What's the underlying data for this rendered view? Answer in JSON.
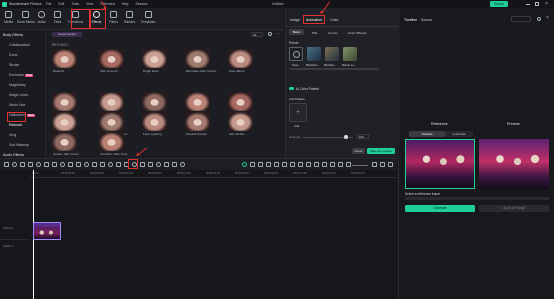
{
  "titlebar": {
    "app_name": "Wondershare Filmora",
    "menus": [
      "File",
      "Edit",
      "Tools",
      "View",
      "Extended",
      "Help",
      "Session"
    ],
    "project": "Untitled",
    "export_label": "Export"
  },
  "toolbar": {
    "tools": [
      {
        "label": "Media",
        "icon": "media-icon"
      },
      {
        "label": "Stock Media",
        "icon": "stock-media-icon"
      },
      {
        "label": "Audio",
        "icon": "audio-icon"
      },
      {
        "label": "Titles",
        "icon": "titles-icon"
      },
      {
        "label": "Transitions",
        "icon": "transitions-icon"
      },
      {
        "label": "Effects",
        "icon": "effects-icon"
      },
      {
        "label": "Filters",
        "icon": "filters-icon"
      },
      {
        "label": "Stickers",
        "icon": "stickers-icon"
      },
      {
        "label": "Templates",
        "icon": "templates-icon"
      }
    ]
  },
  "sidebar": {
    "category": "Body Effects",
    "items": [
      "Collaboration",
      "Done",
      "Stroke",
      "Exclusive",
      "MagicWay",
      "Magic Lines",
      "Neon Line",
      "Halloween",
      "Retouch",
      "Vlog",
      "Suit Makeup"
    ],
    "audio_category": "Audio Effects",
    "badge_exclusive": "NEW",
    "badge_halloween": "NEW"
  },
  "effects": {
    "search_placeholder": "Search effects",
    "filter_label": "Asset Center",
    "filter_value": "All",
    "section": "RETOUCH",
    "thumbs": [
      "Beautify",
      "Skin Smooth",
      "Bright Eyes",
      "Eliminate Dark Circles",
      "Face Blush",
      "Makeup",
      "Slim Face",
      "Face Slim",
      "Forehead",
      "Whitening",
      "AI Smile",
      "Skin Color Enhance",
      "Face Lighting",
      "Natural Portrait",
      "Skin Refine",
      "Golden Skin Tones",
      "Sunshine Skin Tone"
    ]
  },
  "props": {
    "tabs": [
      "Image",
      "Animation",
      "Color"
    ],
    "subtabs": [
      "Basic",
      "HSL",
      "Curves",
      "Color Wheels"
    ],
    "preset_label": "Preset",
    "presets": [
      "None",
      "Blockbus...",
      "Blockbu...",
      "Bokeh Lo..."
    ],
    "ai_color_palette": "AI Color Palette",
    "add_palette": "Add Palette",
    "add_label": "Add",
    "strength_label": "Strength",
    "strength_value": "100",
    "reset_label": "Reset",
    "save_custom_label": "Save as Custom"
  },
  "preview": {
    "tabs": [
      "Timeline",
      "Source"
    ],
    "reference_label": "Reference",
    "preview_label": "Preview",
    "ref_tabs": [
      "Timeline",
      "Local File"
    ],
    "select_frame": "Select a reference frame",
    "generate_label": "Generate",
    "apply_label": "Apply to Range"
  },
  "timeline": {
    "ruler": [
      "00:00",
      "00:00:02:10",
      "00:00:04:20",
      "00:00:07:00",
      "00:00:09:10",
      "00:00:11:20",
      "00:00:14:00",
      "00:00:16:10",
      "00:00:18:20",
      "00:00:21:00",
      "00:00:23:10",
      "00:00:25:20"
    ],
    "track_video": "Video 1",
    "track_audio": "Audio 1"
  },
  "colors": {
    "accent_green": "#1ecf9a",
    "highlight_red": "#e0302f",
    "brand_purple": "#7a55ff"
  }
}
